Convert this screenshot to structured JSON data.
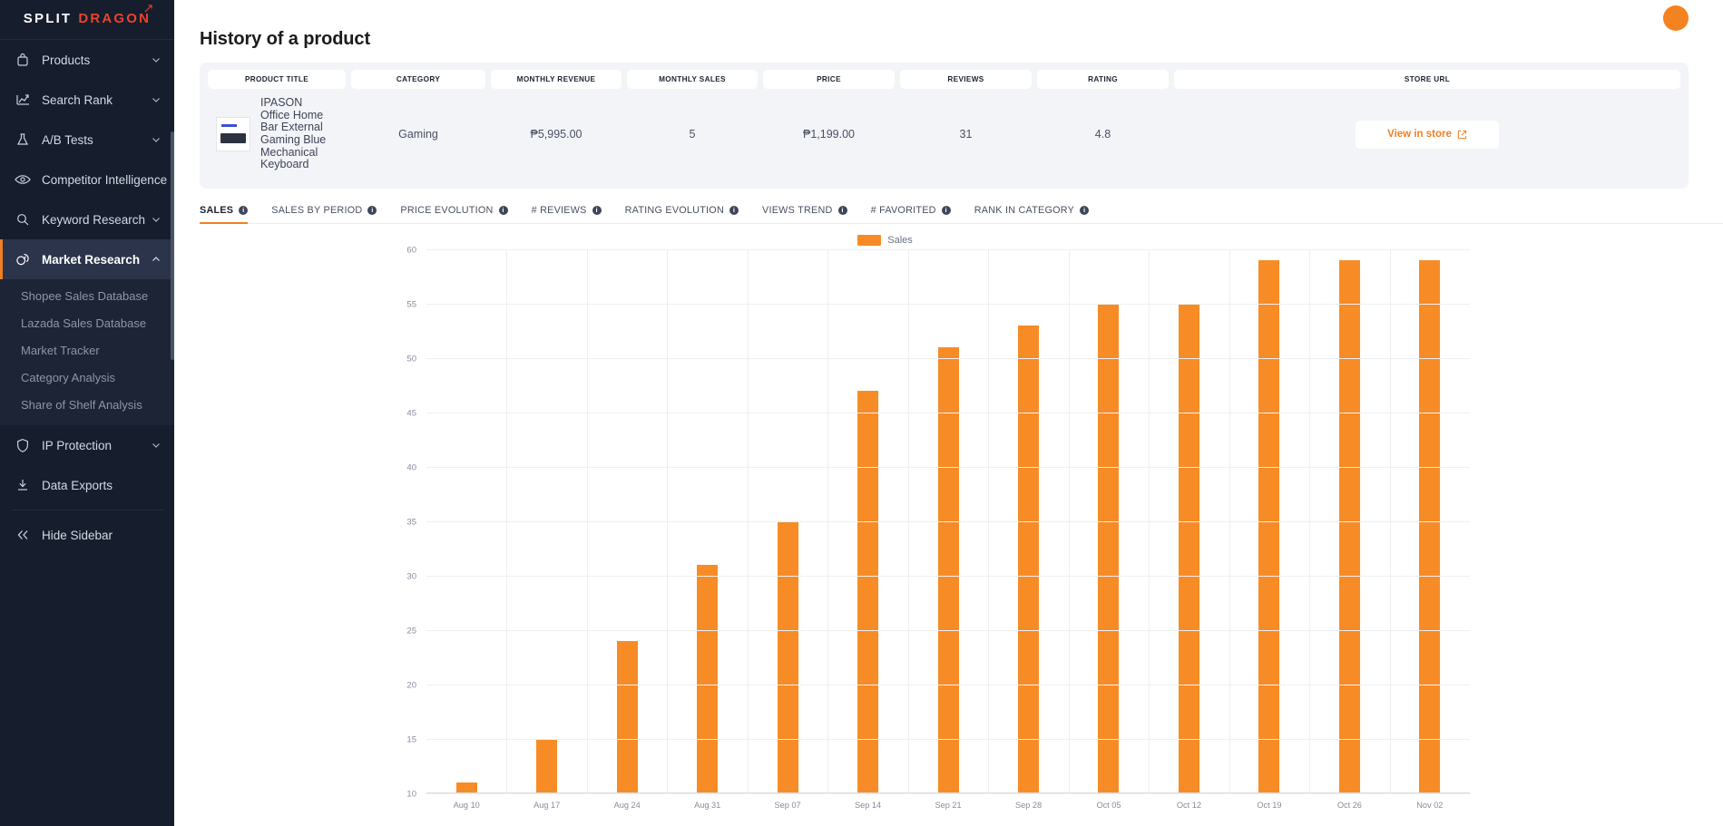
{
  "brand": {
    "word1": "SPLIT",
    "word2": "DRAGON"
  },
  "sidebar": {
    "items": [
      {
        "label": "Products",
        "icon": "bag-icon",
        "expandable": true
      },
      {
        "label": "Search Rank",
        "icon": "chart-line-icon",
        "expandable": true
      },
      {
        "label": "A/B Tests",
        "icon": "flask-icon",
        "expandable": true
      },
      {
        "label": "Competitor Intelligence",
        "icon": "eye-icon",
        "expandable": true
      },
      {
        "label": "Keyword Research",
        "icon": "search-icon",
        "expandable": true
      },
      {
        "label": "Market Research",
        "icon": "market-icon",
        "expandable": true,
        "active": true
      },
      {
        "label": "IP Protection",
        "icon": "shield-icon",
        "expandable": true
      },
      {
        "label": "Data Exports",
        "icon": "download-icon",
        "expandable": false
      }
    ],
    "subitems": [
      "Shopee Sales Database",
      "Lazada Sales Database",
      "Market Tracker",
      "Category Analysis",
      "Share of Shelf Analysis"
    ],
    "hide_sidebar_label": "Hide Sidebar"
  },
  "header": {
    "title": "History of a product"
  },
  "product_table": {
    "columns": [
      "PRODUCT TITLE",
      "CATEGORY",
      "MONTHLY REVENUE",
      "MONTHLY SALES",
      "PRICE",
      "REVIEWS",
      "RATING",
      "STORE URL"
    ],
    "row": {
      "product_title": "IPASON Office Home Bar External Gaming Blue Mechanical Keyboard",
      "category": "Gaming",
      "monthly_revenue": "₱5,995.00",
      "monthly_sales": "5",
      "price": "₱1,199.00",
      "reviews": "31",
      "rating": "4.8",
      "store_url_label": "View in store"
    }
  },
  "tabs": [
    {
      "label": "SALES",
      "active": true
    },
    {
      "label": "SALES BY PERIOD",
      "active": false
    },
    {
      "label": "PRICE EVOLUTION",
      "active": false
    },
    {
      "label": "# REVIEWS",
      "active": false
    },
    {
      "label": "RATING EVOLUTION",
      "active": false
    },
    {
      "label": "VIEWS TREND",
      "active": false
    },
    {
      "label": "# FAVORITED",
      "active": false
    },
    {
      "label": "RANK IN CATEGORY",
      "active": false
    }
  ],
  "chart_data": {
    "type": "bar",
    "title": "",
    "xlabel": "",
    "ylabel": "",
    "legend": [
      "Sales"
    ],
    "legend_position": "top-center",
    "grid": true,
    "ylim": [
      10,
      60
    ],
    "yticks": [
      60,
      55,
      50,
      45,
      40,
      35,
      30,
      25,
      20,
      15,
      10
    ],
    "bar_color": "#f78c26",
    "categories": [
      "Aug 10",
      "Aug 17",
      "Aug 24",
      "Aug 31",
      "Sep 07",
      "Sep 14",
      "Sep 21",
      "Sep 28",
      "Oct 05",
      "Oct 12",
      "Oct 19",
      "Oct 26",
      "Nov 02"
    ],
    "series": [
      {
        "name": "Sales",
        "values": [
          11,
          15,
          24,
          31,
          35,
          47,
          51,
          53,
          55,
          55,
          59,
          59,
          59
        ]
      }
    ]
  },
  "colors": {
    "accent": "#f08023",
    "bar": "#f78c26",
    "sidebar_bg": "#161d2d",
    "brand_red": "#e8452c"
  }
}
